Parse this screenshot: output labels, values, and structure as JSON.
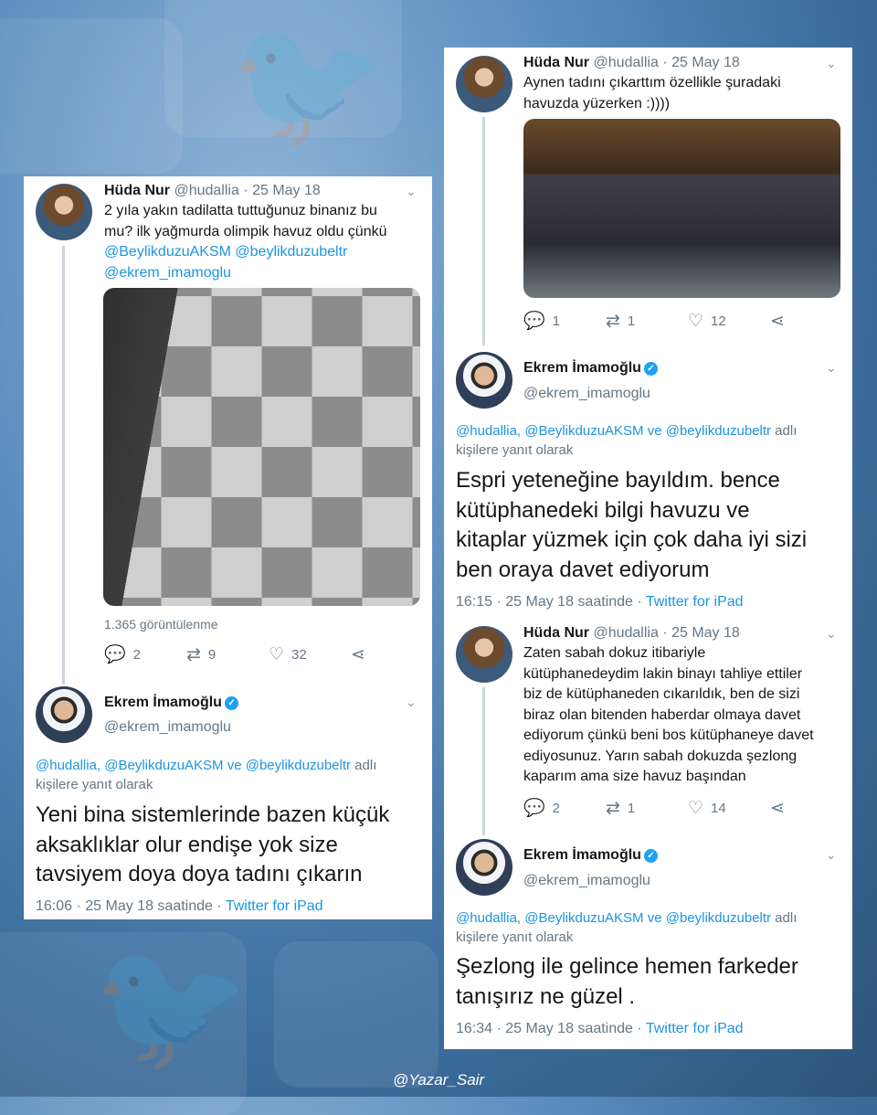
{
  "watermark": "@Yazar_Sair",
  "left": {
    "tweet1": {
      "name": "Hüda Nur",
      "handle": "@hudallia",
      "date": "· 25 May 18",
      "line1": "2 yıla yakın tadilatta tuttuğunuz binanız bu",
      "line2": "mu? ilk yağmurda olimpik havuz oldu çünkü",
      "mentions1": "@BeylikduzuAKSM @beylikduzubeltr",
      "mentions2": "@ekrem_imamoglu",
      "views": "1.365 görüntülenme",
      "replies": "2",
      "retweets": "9",
      "likes": "32"
    },
    "tweet2": {
      "name": "Ekrem İmamoğlu",
      "handle": "@ekrem_imamoglu",
      "reply_mentions": "@hudallia, @BeylikduzuAKSM ve @beylikduzubeltr",
      "reply_suffix": " adlı",
      "reply_line2": "kişilere yanıt olarak",
      "body1": "Yeni bina sistemlerinde bazen küçük",
      "body2": "aksaklıklar olur endişe yok size",
      "body3": "tavsiyem doya doya tadını çıkarın",
      "time": "16:06 · 25 May 18 saatinde · ",
      "source": "Twitter for iPad"
    }
  },
  "right": {
    "tweet1": {
      "name": "Hüda Nur",
      "handle": "@hudallia",
      "date": "· 25 May 18",
      "line1": "Aynen tadını çıkarttım özellikle şuradaki",
      "line2": "havuzda yüzerken :))))",
      "replies": "1",
      "retweets": "1",
      "likes": "12"
    },
    "tweet2": {
      "name": "Ekrem İmamoğlu",
      "handle": "@ekrem_imamoglu",
      "reply_mentions": "@hudallia, @BeylikduzuAKSM ve @beylikduzubeltr",
      "reply_suffix": " adlı",
      "reply_line2": "kişilere yanıt olarak",
      "body1": "Espri yeteneğine bayıldım. bence",
      "body2": "kütüphanedeki bilgi havuzu ve",
      "body3": "kitaplar  yüzmek için çok daha iyi sizi",
      "body4": "ben oraya davet ediyorum",
      "time": "16:15 · 25 May 18 saatinde · ",
      "source": "Twitter for iPad"
    },
    "tweet3": {
      "name": "Hüda Nur",
      "handle": "@hudallia",
      "date": "· 25 May 18",
      "line1": "Zaten sabah dokuz itibariyle",
      "line2": "kütüphanedeydim lakin binayı tahliye ettiler",
      "line3": "biz de kütüphaneden cıkarıldık, ben de sizi",
      "line4": "biraz olan bitenden haberdar olmaya davet",
      "line5": "ediyorum çünkü beni bos kütüphaneye davet",
      "line6": "ediyosunuz. Yarın sabah dokuzda şezlong",
      "line7": "kaparım ama size havuz başından",
      "replies": "2",
      "retweets": "1",
      "likes": "14"
    },
    "tweet4": {
      "name": "Ekrem İmamoğlu",
      "handle": "@ekrem_imamoglu",
      "reply_mentions": "@hudallia, @BeylikduzuAKSM ve @beylikduzubeltr",
      "reply_suffix": " adlı",
      "reply_line2": "kişilere yanıt olarak",
      "body1": "Şezlong ile gelince hemen farkeder",
      "body2": "tanışırız ne güzel .",
      "time": "16:34 · 25 May 18 saatinde · ",
      "source": "Twitter for iPad"
    }
  }
}
